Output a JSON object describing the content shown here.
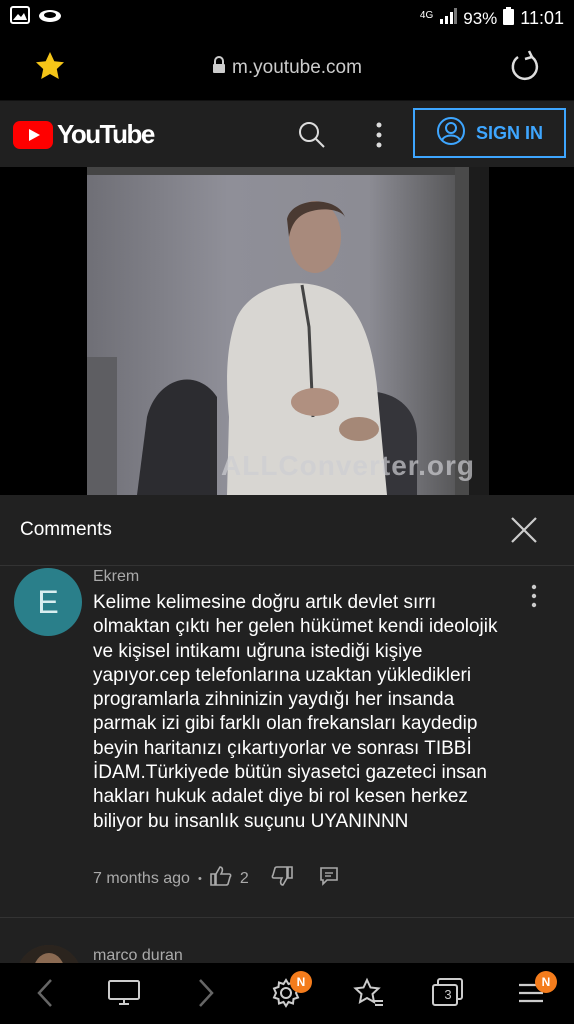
{
  "status_bar": {
    "network": "4G",
    "battery": "93%",
    "time": "11:01"
  },
  "browser": {
    "url": "m.youtube.com"
  },
  "youtube_header": {
    "logo_text": "YouTube",
    "sign_in_label": "SIGN IN",
    "accent": "#3ea6ff"
  },
  "video": {
    "watermark": "ALLConverter.org"
  },
  "comments": {
    "title": "Comments",
    "items": [
      {
        "avatar_letter": "E",
        "author": "Ekrem",
        "text": "Kelime kelimesine doğru artık devlet sırrı olmaktan çıktı her gelen  hükümet kendi ideolojik ve kişisel intikamı uğruna istediği kişiye yapıyor.cep telefonlarına uzaktan yükledikleri programlarla zihninizin yaydığı her insanda parmak izi gibi farklı olan frekansları kaydedip beyin haritanızı çıkartıyorlar ve sonrası TIBBİ İDAM.Türkiyede bütün siyasetci gazeteci insan hakları hukuk adalet diye bi rol kesen herkez biliyor bu insanlık suçunu UYANINNN",
        "time": "7 months ago",
        "separator": "•",
        "likes": "2"
      },
      {
        "author": "marco duran"
      }
    ]
  },
  "bottom_nav": {
    "settings_badge": "N",
    "tabs_count": "3",
    "menu_badge": "N",
    "badge_color": "#f47c1c"
  }
}
